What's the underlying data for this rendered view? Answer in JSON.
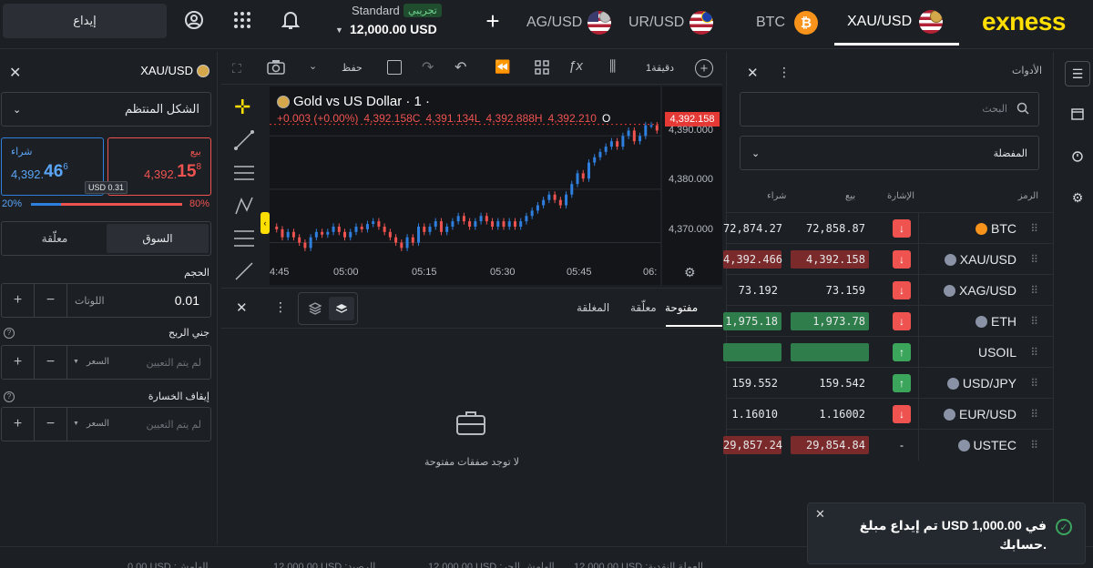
{
  "topbar": {
    "deposit_label": "إيداع",
    "account_type": "Standard",
    "account_badge": "تجريبي",
    "balance": "12,000.00 USD",
    "tabs": [
      {
        "label": "AG/USD",
        "active": false
      },
      {
        "label": "UR/USD",
        "active": false
      },
      {
        "label": "BTC",
        "active": false
      },
      {
        "label": "XAU/USD",
        "active": true
      }
    ],
    "logo": "exness"
  },
  "order_panel": {
    "symbol": "XAU/USD",
    "order_type": "الشكل المنتظم",
    "buy_label": "شراء",
    "buy_price_small": "4,392.",
    "buy_price_big": "46",
    "buy_price_sup": "6",
    "sell_label": "بيع",
    "sell_price_small": "4,392.",
    "sell_price_big": "15",
    "sell_price_sup": "8",
    "spread": "USD 0.31",
    "sentiment_buy": "20%",
    "sentiment_sell": "80%",
    "sentiment_buy_fraction": 0.2,
    "tab_market": "السوق",
    "tab_pending": "معلّقة",
    "volume_label": "الحجم",
    "volume_value": "0.01",
    "volume_unit": "اللوتات",
    "tp_label": "جني الربح",
    "tp_placeholder": "لم يتم التعيين",
    "tp_unit": "السعر",
    "sl_label": "إيقاف الخسارة",
    "sl_placeholder": "لم يتم التعيين",
    "sl_unit": "السعر"
  },
  "chart_toolbar": {
    "save_label": "حفظ",
    "timeframe": "1دقيقة"
  },
  "chart": {
    "title": "Gold vs US Dollar · 1 ·",
    "change": "+0.003 (+0.00%)",
    "ohlc_c": "4,392.158C",
    "ohlc_l": "4,391.134L",
    "ohlc_h": "4,392.888H",
    "ohlc_o": "4,392.210",
    "ohlc_o_letter": "O",
    "last_price": "4,392.158",
    "y_ticks": [
      "4,390.000",
      "4,380.000",
      "4,370.000"
    ],
    "x_ticks": [
      "4:45",
      "05:00",
      "05:15",
      "05:30",
      "05:45",
      "06:"
    ],
    "colors": {
      "up": "#2f7fdf",
      "down": "#ef5350",
      "bg": "#131519"
    }
  },
  "orders": {
    "tabs": [
      "مفتوحة",
      "معلّقة",
      "المغلقة"
    ],
    "active_tab": "مفتوحة",
    "empty_text": "لا توجد صفقات مفتوحة"
  },
  "instruments": {
    "title": "الأدوات",
    "search_placeholder": "البحث",
    "filter": "المفضلة",
    "columns": {
      "symbol": "الرمز",
      "signal": "الإشارة",
      "bid": "بيع",
      "ask": "شراء"
    },
    "rows": [
      {
        "symbol": "BTC",
        "icon": "bitcoin-icon",
        "signal": "↓",
        "signal_color": "#ef5350",
        "bid": "72,858.87",
        "ask": "72,874.27",
        "bid_bg": "transparent",
        "ask_bg": "transparent"
      },
      {
        "symbol": "XAU/USD",
        "icon": "gold-usd-icon",
        "signal": "↓",
        "signal_color": "#ef5350",
        "bid": "4,392.158",
        "ask": "4,392.466",
        "bid_bg": "#7a2a2a",
        "ask_bg": "#7a2a2a"
      },
      {
        "symbol": "XAG/USD",
        "icon": "silver-usd-icon",
        "signal": "↓",
        "signal_color": "#ef5350",
        "bid": "73.159",
        "ask": "73.192",
        "bid_bg": "transparent",
        "ask_bg": "transparent"
      },
      {
        "symbol": "ETH",
        "icon": "ethereum-icon",
        "signal": "↓",
        "signal_color": "#ef5350",
        "bid": "1,973.78",
        "ask": "1,975.18",
        "bid_bg": "#2e7d4a",
        "ask_bg": "#2e7d4a"
      },
      {
        "symbol": "USOIL",
        "icon": "oil-drop-icon",
        "signal": "↑",
        "signal_color": "#3ba55c",
        "bid": "",
        "ask": "",
        "bid_bg": "#2e7d4a",
        "ask_bg": "#2e7d4a"
      },
      {
        "symbol": "USD/JPY",
        "icon": "usd-jpy-icon",
        "signal": "↑",
        "signal_color": "#3ba55c",
        "bid": "159.542",
        "ask": "159.552",
        "bid_bg": "transparent",
        "ask_bg": "transparent"
      },
      {
        "symbol": "EUR/USD",
        "icon": "eur-usd-icon",
        "signal": "↓",
        "signal_color": "#ef5350",
        "bid": "1.16002",
        "ask": "1.16010",
        "bid_bg": "transparent",
        "ask_bg": "transparent"
      },
      {
        "symbol": "USTEC",
        "icon": "us-flag-icon",
        "signal": "-",
        "signal_color": "transparent",
        "bid": "29,854.84",
        "ask": "29,857.24",
        "bid_bg": "#7a2a2a",
        "ask_bg": "#7a2a2a"
      }
    ]
  },
  "toast": {
    "message": "تم إيداع مبلغ USD 1,000.00 في حسابك."
  },
  "bottom": {
    "items": [
      "0.00 USD :الهامش",
      "12,000.00 USD :الرصيد",
      "12,000.00 USD :الهامش الحر",
      "12,000.00 USD :العملة النقدية"
    ]
  }
}
